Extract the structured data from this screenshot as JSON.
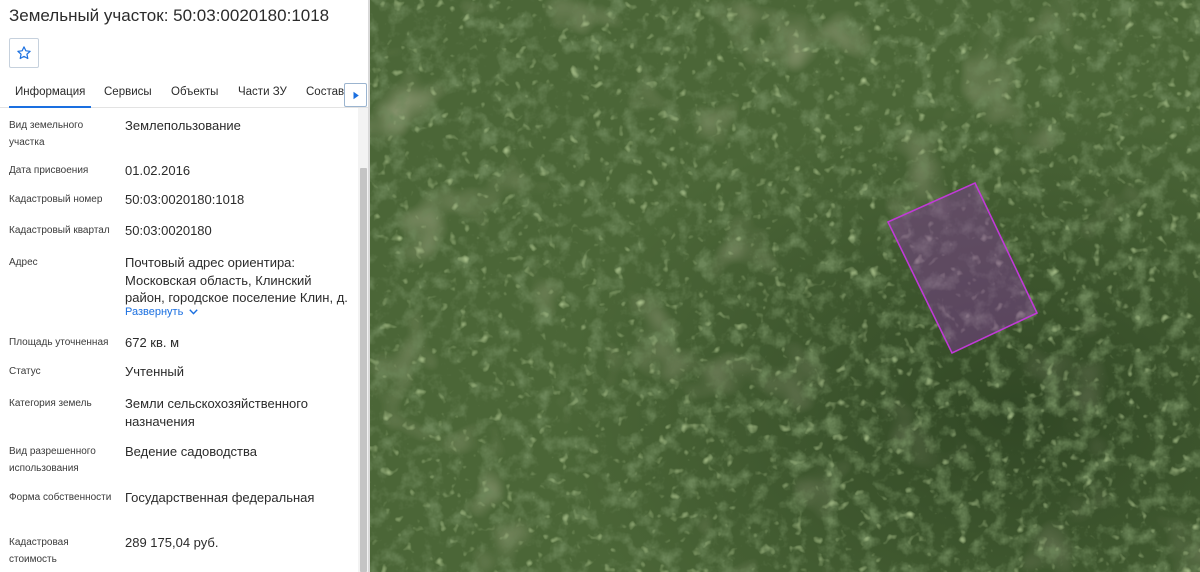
{
  "title": "Земельный участок: 50:03:0020180:1018",
  "icons": {
    "favorite": "star-outline-icon",
    "tabs_next": "triangle-right-icon",
    "expand": "chevron-down-icon"
  },
  "colors": {
    "accent": "#1a6fe0",
    "parcel_outline": "#c03ad6"
  },
  "tabs": [
    {
      "label": "Информация",
      "active": true
    },
    {
      "label": "Сервисы",
      "active": false
    },
    {
      "label": "Объекты",
      "active": false
    },
    {
      "label": "Части ЗУ",
      "active": false
    },
    {
      "label": "Состав",
      "active": false
    }
  ],
  "info": {
    "land_type": {
      "label": "Вид земельного участка",
      "value": "Землепользование"
    },
    "assign_date": {
      "label": "Дата присвоения",
      "value": "01.02.2016"
    },
    "cadastral_number": {
      "label": "Кадастровый номер",
      "value": "50:03:0020180:1018"
    },
    "cadastral_quarter": {
      "label": "Кадастровый квартал",
      "value": "50:03:0020180"
    },
    "address": {
      "label": "Адрес",
      "value": "Почтовый адрес ориентира: Московская область, Клинский район, городское поселение Клин, д.",
      "expand_label": "Развернуть"
    },
    "area": {
      "label": "Площадь уточненная",
      "value": "672 кв. м"
    },
    "status": {
      "label": "Статус",
      "value": "Учтенный"
    },
    "category": {
      "label": "Категория земель",
      "value": "Земли сельскохозяйственного назначения"
    },
    "permitted_use": {
      "label": "Вид разрешенного использования",
      "value": "Ведение садоводства"
    },
    "ownership": {
      "label": "Форма собственности",
      "value": "Государственная федеральная"
    },
    "cadastral_value": {
      "label": "Кадастровая стоимость",
      "value": "289 175,04 руб."
    }
  }
}
